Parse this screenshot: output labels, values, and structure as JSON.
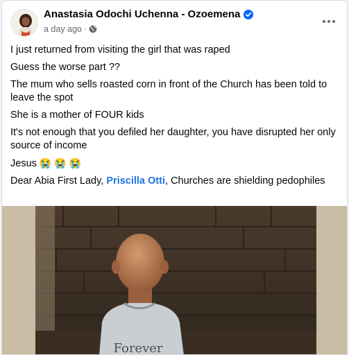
{
  "post": {
    "author": "Anastasia Odochi Uchenna - Ozoemena",
    "timestamp": "a day ago",
    "separator": "·",
    "more_icon": "more-horizontal-icon",
    "verified_icon": "verified-badge-icon",
    "audience_icon": "globe-icon",
    "paragraphs": [
      "I just returned from visiting the girl that was raped",
      "Guess the worse part ??",
      "The mum who sells roasted corn in front of the Church has been told to leave the spot",
      "She is a  mother of FOUR kids",
      "It's not enough that you defiled her daughter,  you have disrupted her only source of income"
    ],
    "jesus_text": "Jesus",
    "emojis": [
      "😭",
      "😭",
      "😭"
    ],
    "closing_prefix": "Dear Abia First Lady,",
    "mention": "Priscilla Otti",
    "closing_suffix": ", Churches are shielding pedophiles",
    "shirt_text": "Forever"
  },
  "colors": {
    "link": "#1b74e4",
    "secondary_text": "#65676b",
    "verified": "#0866ff"
  }
}
